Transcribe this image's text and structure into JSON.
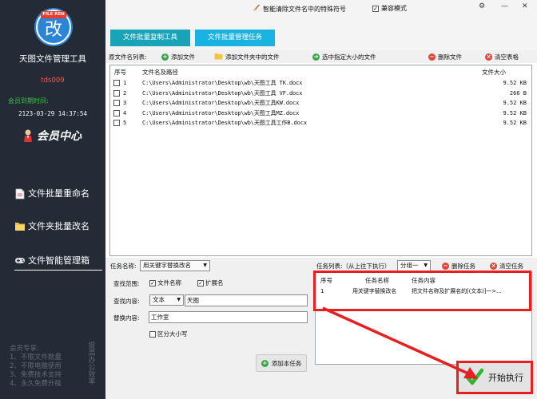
{
  "app": {
    "logo_tag": "FILE REN",
    "logo_char": "改",
    "title": "天图文件管理工具",
    "user": "tds009",
    "expiry_label": "会员到期时间:",
    "expiry_date": "2123-03-29 14:37:54",
    "member_center": "会员中心"
  },
  "sidebar": {
    "items": [
      {
        "label": "文件批量重命名",
        "icon": "document-icon"
      },
      {
        "label": "文件夹批量改名",
        "icon": "folder-icon"
      },
      {
        "label": "文件智能管理箱",
        "icon": "gamepad-icon"
      }
    ],
    "promo_lines": [
      "会员专享:",
      "1、不限文件数量",
      "2、不限电脑使用",
      "3、免费技术支持",
      "4、永久免费升级"
    ],
    "promo_vertical": "提高办公效率"
  },
  "topbar": {
    "special_chars_label": "智能清除文件名中的特殊符号",
    "compat_label": "兼容模式",
    "compat_checked": true,
    "tabs": [
      "文件批量复制工具",
      "文件批量管理任务"
    ]
  },
  "toolbar": {
    "list_label": "原文件名列表:",
    "add_file": "添加文件",
    "add_folder_files": "添加文件夹中的文件",
    "select_by_size": "选中指定大小的文件",
    "delete_file": "删除文件",
    "clear_table": "清空表格"
  },
  "file_table": {
    "headers": [
      "序号",
      "文件名及路径",
      "文件大小"
    ],
    "rows": [
      {
        "num": "1",
        "path": "C:\\Users\\Administrator\\Desktop\\wb\\天图工具 TK.docx",
        "size": "9.52 KB"
      },
      {
        "num": "2",
        "path": "C:\\Users\\Administrator\\Desktop\\wb\\天图工具 VF.docx",
        "size": "266 B"
      },
      {
        "num": "3",
        "path": "C:\\Users\\Administrator\\Desktop\\wb\\天图工具KW.docx",
        "size": "9.52 KB"
      },
      {
        "num": "4",
        "path": "C:\\Users\\Administrator\\Desktop\\wb\\天图工具MZ.docx",
        "size": "9.52 KB"
      },
      {
        "num": "5",
        "path": "C:\\Users\\Administrator\\Desktop\\wb\\天图工具工作B.docx",
        "size": "9.52 KB"
      }
    ]
  },
  "task_editor": {
    "task_name_label": "任务名称:",
    "task_name_value": "用关键字替换改名",
    "scope_label": "查找范围:",
    "scope_filename": "文件名称",
    "scope_ext": "扩展名",
    "find_label": "查找内容:",
    "find_type": "文本",
    "find_value": "天图",
    "replace_label": "替换内容:",
    "replace_value": "工作室",
    "case_label": "区分大小写",
    "add_task": "添加本任务"
  },
  "task_list": {
    "label": "任务列表:（从上往下执行）",
    "group": "分组一",
    "delete_task": "删除任务",
    "clear_task": "清空任务",
    "headers": [
      "序号",
      "任务名称",
      "任务内容"
    ],
    "rows": [
      {
        "num": "1",
        "name": "用关键字替换改名",
        "content": "把文件名称及扩展名的[(文本)]一>..."
      }
    ]
  },
  "start_button": "开始执行",
  "colors": {
    "sidebar_bg": "#232b36",
    "accent_teal": "#18a3b7",
    "accent_blue": "#19b3e2",
    "highlight_red": "#e62020",
    "user_red": "#ff5a4a",
    "expiry_green": "#39c23e"
  }
}
